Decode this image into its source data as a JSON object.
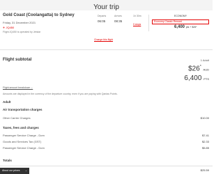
{
  "header": {
    "title": "Your trip"
  },
  "flight": {
    "route": "Gold Coast (Coolangatta) to Sydney",
    "date": "Friday, 31 December 2021",
    "flight_number": "✈ JQ450",
    "operated_by": "Flight JQ450 is operated by Jetstar",
    "departs_label": "Departs",
    "departs_time": "06:05",
    "arrives_label": "Arrives",
    "arrives_time": "08:35",
    "duration_label": "1h 30m",
    "stops": "0 stops",
    "cabin": "ECONOMY",
    "fare_type": "Economy Classic Reward",
    "mini_price": "6,400",
    "mini_price_unit": "pts + $26*",
    "change_link": "Change this flight"
  },
  "subtotal": {
    "title": "Flight subtotal",
    "adult_count": "1 Adult",
    "price": "$26",
    "price_sup": "*",
    "price_unit": "AUD",
    "points": "6,400",
    "points_unit": "PTS",
    "breakdown_link": "Flight amount breakdown ⌄",
    "currency_note": "Amounts are displayed in the currency of the departure country, even if you are paying with Qantas Points."
  },
  "breakdown": {
    "adult_label": "Adult",
    "air_transport_label": "Air transportation charges",
    "carrier_label": "Other Carrier Charges",
    "carrier_value": "$10.00",
    "taxes_label": "Taxes, fees and charges",
    "items": [
      {
        "label": "Passenger Service Charge - Dom",
        "value": "$7.41"
      },
      {
        "label": "Goods and Services Tax (GST)",
        "value": "$2.33"
      },
      {
        "label": "Passenger Service Charge - Dom",
        "value": "$5.85"
      }
    ],
    "totals_label": "Totals",
    "total_value": "$25.59"
  },
  "footer": {
    "badge_label": "About our prices",
    "badge_chevron": "⌄"
  },
  "colors": {
    "accent": "#e40000",
    "text": "#323232",
    "header_bg": "#f4f4f4"
  }
}
